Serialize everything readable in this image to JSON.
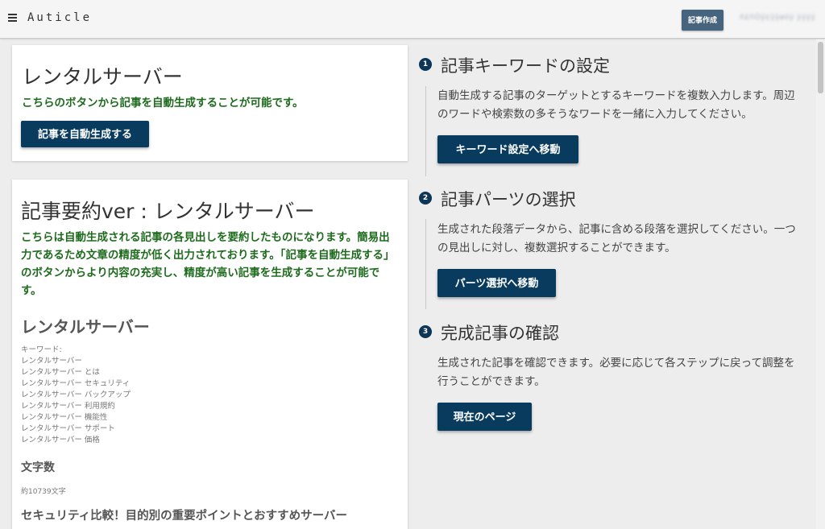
{
  "header": {
    "logo": "Auticle",
    "create_button": "記事作成",
    "user_name": "ñ£ñÖÿ¢ÿÿøöÿ ÿÿÿÿ"
  },
  "card1": {
    "title": "レンタルサーバー",
    "description": "こちらのボタンから記事を自動生成することが可能です。",
    "button": "記事を自動生成する"
  },
  "card2": {
    "title": "記事要約ver : レンタルサーバー",
    "description": "こちらは自動生成される記事の各見出しを要約したものになります。簡易出力であるため文章の精度が低く出力されております。「記事を自動生成する」のボタンからより内容の充実し、精度が高い記事を生成することが可能です。",
    "summary_heading": "レンタルサーバー",
    "keywords_label": "キーワード:",
    "keywords": [
      "レンタルサーバー",
      "レンタルサーバー とは",
      "レンタルサーバー セキュリティ",
      "レンタルサーバー バックアップ",
      "レンタルサーバー 利用規約",
      "レンタルサーバー 機能性",
      "レンタルサーバー サポート",
      "レンタルサーバー 価格"
    ],
    "char_count_heading": "文字数",
    "char_count_value": "約10739文字",
    "section_heading": "セキュリティ比較！目的別の重要ポイントとおすすめサーバー"
  },
  "steps": [
    {
      "number": "1",
      "title": "記事キーワードの設定",
      "description": "自動生成する記事のターゲットとするキーワードを複数入力します。周辺のワードや検索数の多そうなワードを一緒に入力してください。",
      "button": "キーワード設定へ移動"
    },
    {
      "number": "2",
      "title": "記事パーツの選択",
      "description": "生成された段落データから、記事に含める段落を選択してください。一つの見出しに対し、複数選択することができます。",
      "button": "パーツ選択へ移動"
    },
    {
      "number": "3",
      "title": "完成記事の確認",
      "description": "生成された記事を確認できます。必要に応じて各ステップに戻って調整を行うことができます。",
      "button": "現在のページ"
    }
  ],
  "colors": {
    "primary": "#083b5e",
    "header_button": "#47647f",
    "green_text": "#1e6b1e",
    "background": "#ededed"
  }
}
